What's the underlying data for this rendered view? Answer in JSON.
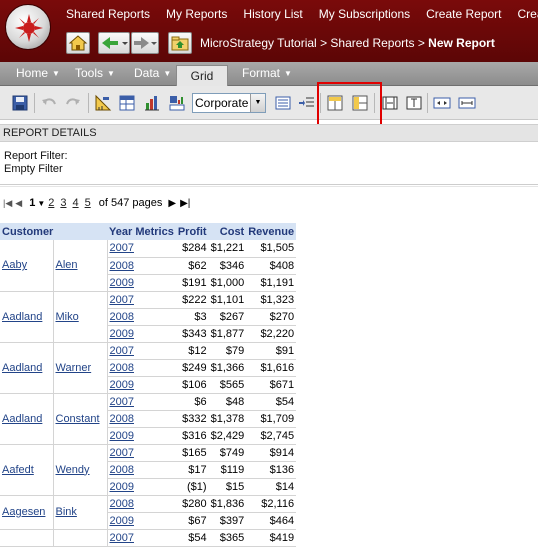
{
  "app": {
    "nav_links": [
      "Shared Reports",
      "My Reports",
      "History List",
      "My Subscriptions",
      "Create Report",
      "Create"
    ],
    "breadcrumb": {
      "project": "MicroStrategy Tutorial",
      "sep1": ">",
      "folder": "Shared Reports",
      "sep2": ">",
      "current": "New Report"
    }
  },
  "menu_tabs": {
    "home": "Home",
    "tools": "Tools",
    "data": "Data",
    "grid": "Grid",
    "format": "Format"
  },
  "toolbar": {
    "style_value": "Corporate",
    "icons": [
      "save-icon",
      "undo-icon",
      "redo-icon",
      "design-icon",
      "grid-view-icon",
      "graph-view-icon",
      "grid-graph-icon",
      "outline-icon",
      "add-column-icon",
      "merge-header-icon",
      "lock-header-icon",
      "resize-columns-icon",
      "auto-fit-icon",
      "freeze-icon",
      "wrap-icon"
    ]
  },
  "details": {
    "title": "REPORT DETAILS",
    "filter_label": "Report Filter:",
    "filter_value": "Empty Filter"
  },
  "pager": {
    "current": "1",
    "pages": [
      "2",
      "3",
      "4",
      "5"
    ],
    "total": "of 547 pages"
  },
  "grid": {
    "headers": {
      "customer": "Customer",
      "year": "Year",
      "metrics": "Metrics",
      "profit": "Profit",
      "cost": "Cost",
      "revenue": "Revenue"
    },
    "groups": [
      {
        "last": "Aaby",
        "first": "Alen",
        "rows": [
          {
            "year": "2007",
            "profit": "$284",
            "cost": "$1,221",
            "revenue": "$1,505"
          },
          {
            "year": "2008",
            "profit": "$62",
            "cost": "$346",
            "revenue": "$408"
          },
          {
            "year": "2009",
            "profit": "$191",
            "cost": "$1,000",
            "revenue": "$1,191"
          }
        ]
      },
      {
        "last": "Aadland",
        "first": "Miko",
        "rows": [
          {
            "year": "2007",
            "profit": "$222",
            "cost": "$1,101",
            "revenue": "$1,323"
          },
          {
            "year": "2008",
            "profit": "$3",
            "cost": "$267",
            "revenue": "$270"
          },
          {
            "year": "2009",
            "profit": "$343",
            "cost": "$1,877",
            "revenue": "$2,220"
          }
        ]
      },
      {
        "last": "Aadland",
        "first": "Warner",
        "rows": [
          {
            "year": "2007",
            "profit": "$12",
            "cost": "$79",
            "revenue": "$91"
          },
          {
            "year": "2008",
            "profit": "$249",
            "cost": "$1,366",
            "revenue": "$1,616"
          },
          {
            "year": "2009",
            "profit": "$106",
            "cost": "$565",
            "revenue": "$671"
          }
        ]
      },
      {
        "last": "Aadland",
        "first": "Constant",
        "rows": [
          {
            "year": "2007",
            "profit": "$6",
            "cost": "$48",
            "revenue": "$54"
          },
          {
            "year": "2008",
            "profit": "$332",
            "cost": "$1,378",
            "revenue": "$1,709"
          },
          {
            "year": "2009",
            "profit": "$316",
            "cost": "$2,429",
            "revenue": "$2,745"
          }
        ]
      },
      {
        "last": "Aafedt",
        "first": "Wendy",
        "rows": [
          {
            "year": "2007",
            "profit": "$165",
            "cost": "$749",
            "revenue": "$914"
          },
          {
            "year": "2008",
            "profit": "$17",
            "cost": "$119",
            "revenue": "$136"
          },
          {
            "year": "2009",
            "profit": "($1)",
            "cost": "$15",
            "revenue": "$14"
          }
        ]
      },
      {
        "last": "Aagesen",
        "first": "Bink",
        "rows": [
          {
            "year": "2008",
            "profit": "$280",
            "cost": "$1,836",
            "revenue": "$2,116"
          },
          {
            "year": "2009",
            "profit": "$67",
            "cost": "$397",
            "revenue": "$464"
          }
        ]
      },
      {
        "last": "",
        "first": "",
        "rows": [
          {
            "year": "2007",
            "profit": "$54",
            "cost": "$365",
            "revenue": "$419"
          }
        ]
      }
    ]
  }
}
